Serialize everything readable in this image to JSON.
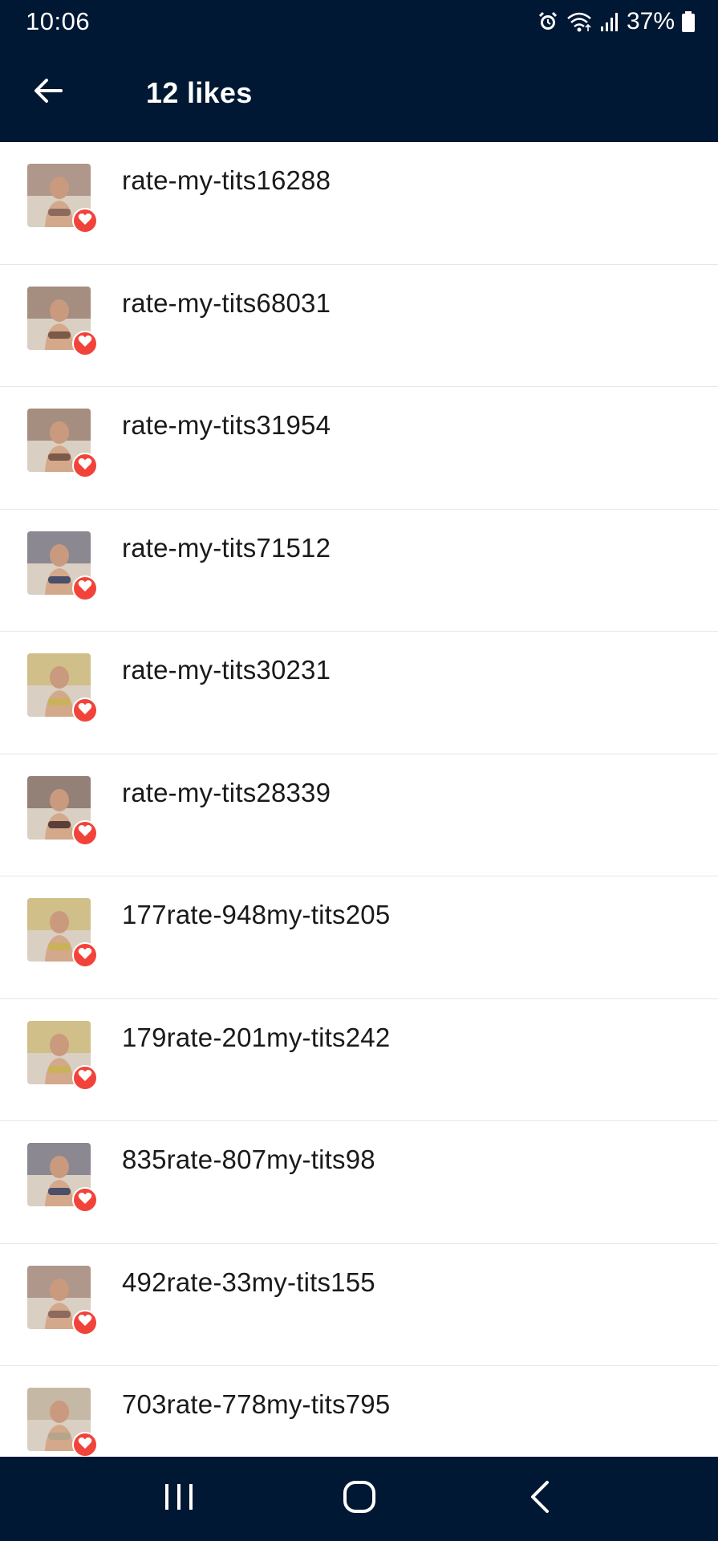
{
  "status_bar": {
    "time": "10:06",
    "battery": "37%",
    "icons": [
      "alarm-icon",
      "wifi-icon",
      "signal-icon",
      "battery-icon"
    ]
  },
  "app_bar": {
    "back_icon": "arrow-left-icon",
    "title": "12 likes"
  },
  "likes": [
    {
      "username": "rate-my-tits16288",
      "avatar_tone": "#8c6a5d"
    },
    {
      "username": "rate-my-tits68031",
      "avatar_tone": "#7a5a48"
    },
    {
      "username": "rate-my-tits31954",
      "avatar_tone": "#7a5a48"
    },
    {
      "username": "rate-my-tits71512",
      "avatar_tone": "#4a4f6a"
    },
    {
      "username": "rate-my-tits30231",
      "avatar_tone": "#c9b35a"
    },
    {
      "username": "rate-my-tits28339",
      "avatar_tone": "#5a4038"
    },
    {
      "username": "177rate-948my-tits205",
      "avatar_tone": "#c9b35a"
    },
    {
      "username": "179rate-201my-tits242",
      "avatar_tone": "#c9b35a"
    },
    {
      "username": "835rate-807my-tits98",
      "avatar_tone": "#4a4f6a"
    },
    {
      "username": "492rate-33my-tits155",
      "avatar_tone": "#8c6a5d"
    },
    {
      "username": "703rate-778my-tits795",
      "avatar_tone": "#b5a58a"
    }
  ],
  "badge_icon": "heart-icon",
  "colors": {
    "header_bg": "#001833",
    "badge": "#f2433a",
    "divider": "#e6e6e6"
  },
  "nav_bar": {
    "icons": [
      "recent-apps-icon",
      "home-icon",
      "back-icon"
    ]
  }
}
